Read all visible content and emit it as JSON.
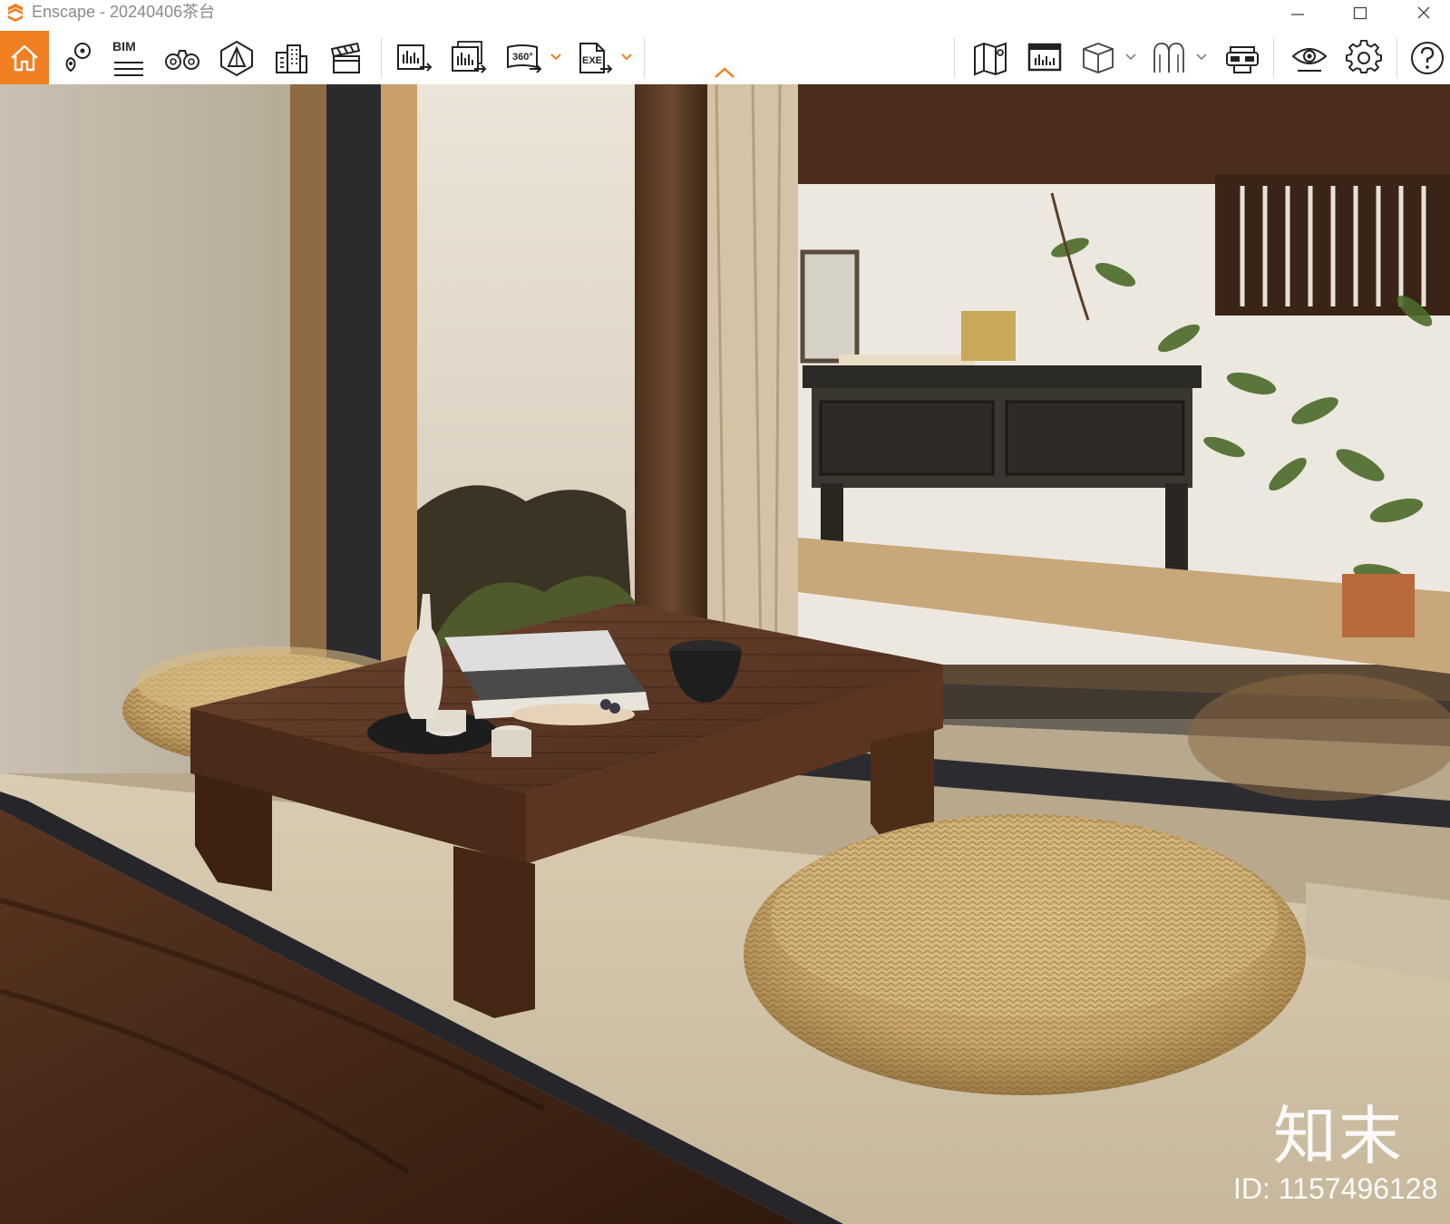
{
  "window": {
    "app_name": "Enscape",
    "title": "Enscape - 20240406茶台",
    "controls": [
      "minimize",
      "maximize",
      "close"
    ]
  },
  "toolbar": {
    "active": "home",
    "accent_color": "#f07f22",
    "left_group": [
      {
        "id": "home",
        "icon": "home-icon",
        "active": true
      },
      {
        "id": "views",
        "icon": "map-pin-icon"
      },
      {
        "id": "bim",
        "icon": "bim-icon",
        "label": "BIM"
      },
      {
        "id": "walk",
        "icon": "binoculars-icon"
      },
      {
        "id": "sketch",
        "icon": "pyramid-icon"
      },
      {
        "id": "asset-library",
        "icon": "buildings-icon"
      },
      {
        "id": "video-editor",
        "icon": "clapperboard-icon"
      }
    ],
    "export_group": [
      {
        "id": "screenshot",
        "icon": "screenshot-export-icon"
      },
      {
        "id": "batch-render",
        "icon": "batch-render-icon"
      },
      {
        "id": "panorama",
        "icon": "panorama-360-icon",
        "label": "360°",
        "dropdown": true
      },
      {
        "id": "standalone",
        "icon": "exe-export-icon",
        "label": "EXE",
        "dropdown": true
      }
    ],
    "collapse_icon": "chevron-up-icon",
    "right_group": [
      {
        "id": "map",
        "icon": "map-icon"
      },
      {
        "id": "monitor",
        "icon": "monitor-icon"
      },
      {
        "id": "cube",
        "icon": "cube-icon",
        "dropdown": true
      },
      {
        "id": "materials",
        "icon": "arches-icon",
        "dropdown": true
      },
      {
        "id": "vr",
        "icon": "vr-headset-icon"
      },
      {
        "id": "visual-settings",
        "icon": "eye-icon"
      },
      {
        "id": "settings",
        "icon": "gear-icon"
      },
      {
        "id": "help",
        "icon": "help-icon"
      }
    ]
  },
  "viewport": {
    "scene": "Tea table on tatami platform with woven cushions by a window",
    "watermark_logo": "知末",
    "watermark_id": "ID: 1157496128"
  }
}
